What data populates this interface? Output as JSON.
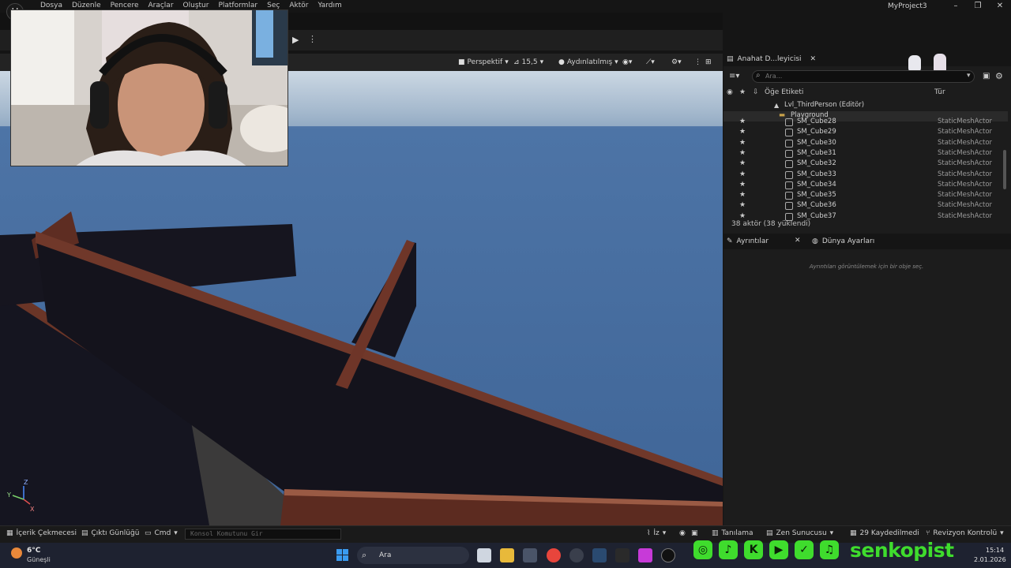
{
  "menubar": {
    "items": [
      "Dosya",
      "Düzenle",
      "Pencere",
      "Araçlar",
      "Oluştur",
      "Platformlar",
      "Seç",
      "Aktör",
      "Yardım"
    ],
    "project_name": "MyProject3"
  },
  "viewport": {
    "perspective": "Perspektif",
    "fov": "15,5",
    "lighting": "Aydınlatılmış",
    "axis_labels": {
      "z": "Z",
      "y": "Y",
      "x": "X"
    }
  },
  "outliner": {
    "tab_label": "Anahat D...leyicisi",
    "search_placeholder": "Ara...",
    "col_label": "Öğe Etiketi",
    "col_type": "Tür",
    "level": "Lvl_ThirdPerson (Editör)",
    "folder": "Playground",
    "rows": [
      {
        "name": "SM_Cube28",
        "type": "StaticMeshActor"
      },
      {
        "name": "SM_Cube29",
        "type": "StaticMeshActor"
      },
      {
        "name": "SM_Cube30",
        "type": "StaticMeshActor"
      },
      {
        "name": "SM_Cube31",
        "type": "StaticMeshActor"
      },
      {
        "name": "SM_Cube32",
        "type": "StaticMeshActor"
      },
      {
        "name": "SM_Cube33",
        "type": "StaticMeshActor"
      },
      {
        "name": "SM_Cube34",
        "type": "StaticMeshActor"
      },
      {
        "name": "SM_Cube35",
        "type": "StaticMeshActor"
      },
      {
        "name": "SM_Cube36",
        "type": "StaticMeshActor"
      },
      {
        "name": "SM_Cube37",
        "type": "StaticMeshActor"
      }
    ],
    "actor_count": "38 aktör (38 yüklendi)"
  },
  "details": {
    "tab_label": "Ayrıntılar",
    "world_tab_label": "Dünya Ayarları",
    "empty_message": "Ayrıntıları görüntülemek için bir obje seç."
  },
  "statusbar": {
    "content_drawer": "İçerik Çekmecesi",
    "output_log": "Çıktı Günlüğü",
    "cmd": "Cmd",
    "console_placeholder": "Konsol Komutunu Gir",
    "trace": "İz",
    "diagnostics": "Tanılama",
    "zen_server": "Zen Sunucusu",
    "unsaved": "29 Kaydedilmedi",
    "revision_control": "Revizyon Kontrolü"
  },
  "taskbar": {
    "temperature": "6°C",
    "weather": "Güneşli",
    "search_label": "Ara",
    "time": "15:14",
    "date": "2.01.2026"
  },
  "overlay": {
    "social_name": "senkopist"
  },
  "colors": {
    "sky": "#4a6e9c",
    "wall_dark": "#1b1a2a",
    "brick": "#7a3a2a",
    "social_green": "#3fdc2d"
  }
}
